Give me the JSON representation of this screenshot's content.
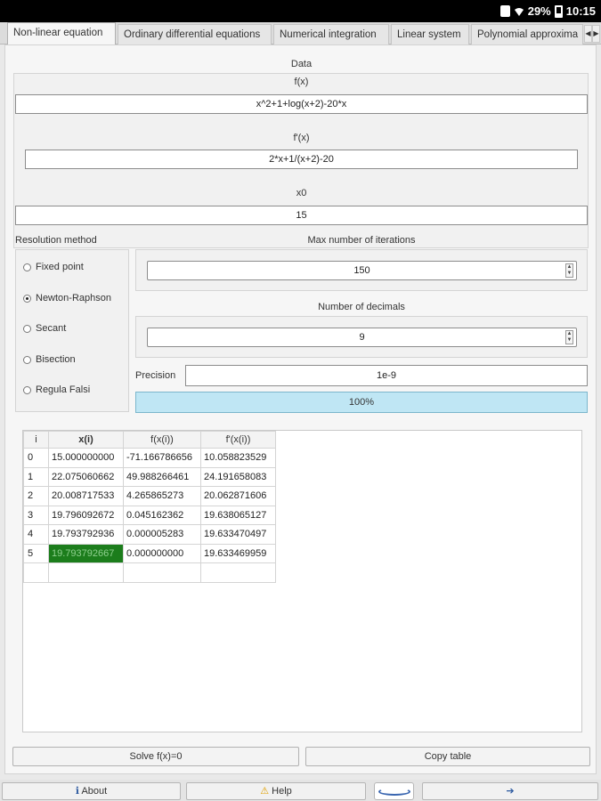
{
  "status": {
    "battery": "29%",
    "time": "10:15"
  },
  "tabs": [
    {
      "label": "Non-linear equation",
      "active": true
    },
    {
      "label": "Ordinary differential equations",
      "active": false
    },
    {
      "label": "Numerical integration",
      "active": false
    },
    {
      "label": "Linear system",
      "active": false
    },
    {
      "label": "Polynomial approxima",
      "active": false
    }
  ],
  "data_section": {
    "title": "Data",
    "fx_label": "f(x)",
    "fx_value": "x^2+1+log(x+2)-20*x",
    "dfx_label": "f'(x)",
    "dfx_value": "2*x+1/(x+2)-20",
    "x0_label": "x0",
    "x0_value": "15"
  },
  "resolution": {
    "label": "Resolution method",
    "methods": [
      {
        "label": "Fixed point",
        "checked": false
      },
      {
        "label": "Newton-Raphson",
        "checked": true
      },
      {
        "label": "Secant",
        "checked": false
      },
      {
        "label": "Bisection",
        "checked": false
      },
      {
        "label": "Regula Falsi",
        "checked": false
      }
    ]
  },
  "max_iterations": {
    "label": "Max number of iterations",
    "value": "150"
  },
  "decimals": {
    "label": "Number of decimals",
    "value": "9"
  },
  "precision": {
    "label": "Precision",
    "value": "1e-9"
  },
  "progress": {
    "text": "100%",
    "fraction": 1.0
  },
  "table": {
    "headers": [
      "i",
      "x(i)",
      "f(x(i))",
      "f'(x(i))"
    ],
    "rows": [
      [
        "0",
        "15.000000000",
        "-71.166786656",
        "10.058823529"
      ],
      [
        "1",
        "22.075060662",
        "49.988266461",
        "24.191658083"
      ],
      [
        "2",
        "20.008717533",
        "4.265865273",
        "20.062871606"
      ],
      [
        "3",
        "19.796092672",
        "0.045162362",
        "19.638065127"
      ],
      [
        "4",
        "19.793792936",
        "0.000005283",
        "19.633470497"
      ],
      [
        "5",
        "19.793792667",
        "0.000000000",
        "19.633469959"
      ]
    ]
  },
  "buttons": {
    "solve": "Solve f(x)=0",
    "copy": "Copy table"
  },
  "bottom": {
    "about": "About",
    "help": "Help"
  }
}
